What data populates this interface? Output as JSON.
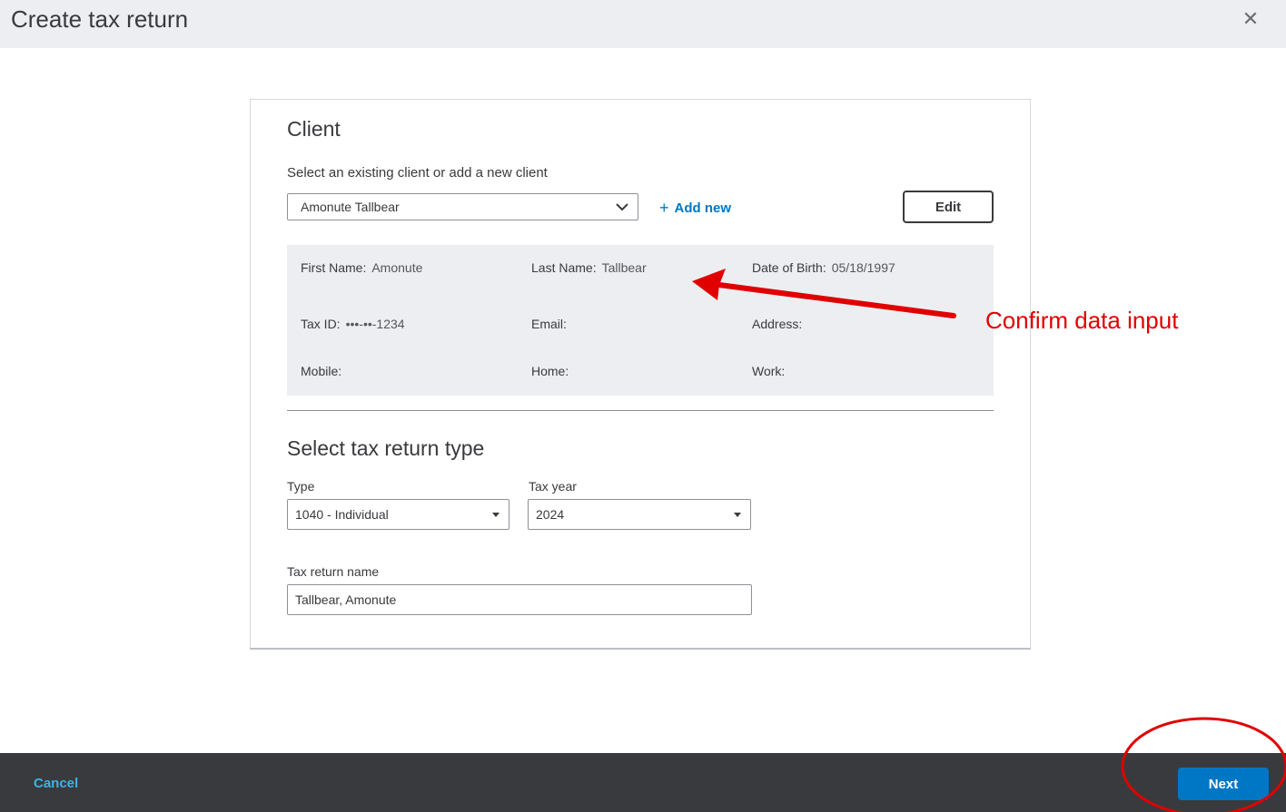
{
  "header": {
    "title": "Create tax return",
    "close_icon": "close-icon"
  },
  "client": {
    "section_title": "Client",
    "select_label": "Select an existing client or add a new client",
    "selected_client": "Amonute Tallbear",
    "add_new_label": "Add new",
    "edit_label": "Edit",
    "info": {
      "first_name_label": "First Name:",
      "first_name": "Amonute",
      "last_name_label": "Last Name:",
      "last_name": "Tallbear",
      "dob_label": "Date of Birth:",
      "dob": "05/18/1997",
      "tax_id_label": "Tax ID:",
      "tax_id": "•••-••-1234",
      "email_label": "Email:",
      "email": "",
      "address_label": "Address:",
      "address": "",
      "mobile_label": "Mobile:",
      "mobile": "",
      "home_label": "Home:",
      "home": "",
      "work_label": "Work:",
      "work": ""
    }
  },
  "tax_return": {
    "section_title": "Select tax return type",
    "type_label": "Type",
    "type_value": "1040 - Individual",
    "year_label": "Tax year",
    "year_value": "2024",
    "name_label": "Tax return name",
    "name_value": "Tallbear, Amonute"
  },
  "footer": {
    "cancel_label": "Cancel",
    "next_label": "Next"
  },
  "annotation": {
    "text": "Confirm data input",
    "color": "#e00000"
  },
  "colors": {
    "accent": "#0077c5",
    "link_dark_bg": "#3bb4e5",
    "footer_bg": "#393a3d"
  }
}
